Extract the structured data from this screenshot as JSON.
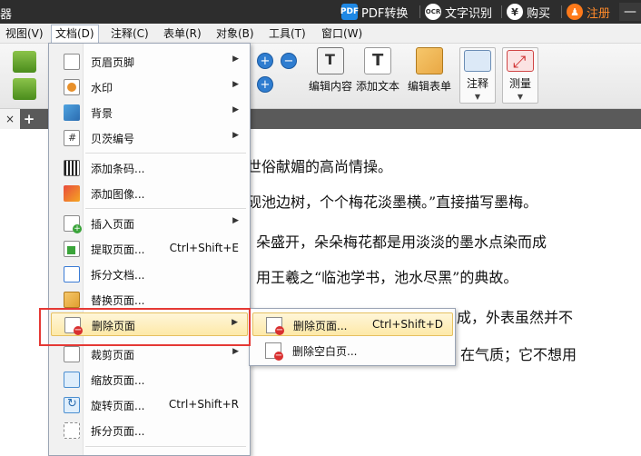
{
  "titlebar": {
    "app_title": "器",
    "pdf_convert": "PDF转换",
    "pdf_icon": "PDF",
    "ocr": "文字识别",
    "ocr_icon": "OCR",
    "buy": "购买",
    "yen_icon": "¥",
    "register": "注册",
    "user_icon": "♟",
    "minimize": "—"
  },
  "menubar": {
    "items": [
      "视图(V)",
      "文档(D)",
      "注释(C)",
      "表单(R)",
      "对象(B)",
      "工具(T)",
      "窗口(W)"
    ],
    "active": "文档(D)"
  },
  "ribbon": {
    "zoom_in": "+",
    "zoom_out": "−",
    "zoom_plus": "+",
    "buttons": [
      "编辑内容",
      "添加文本",
      "编辑表单",
      "注释",
      "测量"
    ],
    "dropdown_arrow": "▼"
  },
  "tabs": {
    "close": "×",
    "add": "+"
  },
  "document": {
    "lines": [
      "世俗献媚的高尚情操。",
      "砚池边树，个个梅花淡墨横。”直接描写墨梅。",
      "朵盛开，朵朵梅花都是用淡淡的墨水点染而成",
      "用王羲之“临池学书，池水尽黑”的典故。",
      "成，外表虽然并不",
      "在气质；它不想用"
    ]
  },
  "menu_doc": {
    "items": [
      {
        "label": "页眉页脚",
        "submenu": true
      },
      {
        "label": "水印",
        "submenu": true
      },
      {
        "label": "背景",
        "submenu": true
      },
      {
        "label": "贝茨编号",
        "submenu": true
      },
      {
        "label": "添加条码..."
      },
      {
        "label": "添加图像..."
      },
      {
        "label": "插入页面",
        "submenu": true
      },
      {
        "label": "提取页面...",
        "shortcut": "Ctrl+Shift+E"
      },
      {
        "label": "拆分文档..."
      },
      {
        "label": "替换页面..."
      },
      {
        "label": "删除页面",
        "submenu": true,
        "highlighted": true
      },
      {
        "label": "裁剪页面",
        "submenu": true
      },
      {
        "label": "缩放页面..."
      },
      {
        "label": "旋转页面...",
        "shortcut": "Ctrl+Shift+R"
      },
      {
        "label": "拆分页面..."
      }
    ],
    "submenu_arrow": "▶"
  },
  "submenu_delete": {
    "items": [
      {
        "label": "删除页面...",
        "shortcut": "Ctrl+Shift+D",
        "highlighted": true
      },
      {
        "label": "删除空白页..."
      }
    ]
  },
  "colors": {
    "highlight_box": "#e53935",
    "menu_highlight": "#fde9a8",
    "register": "#ff8a2a"
  }
}
